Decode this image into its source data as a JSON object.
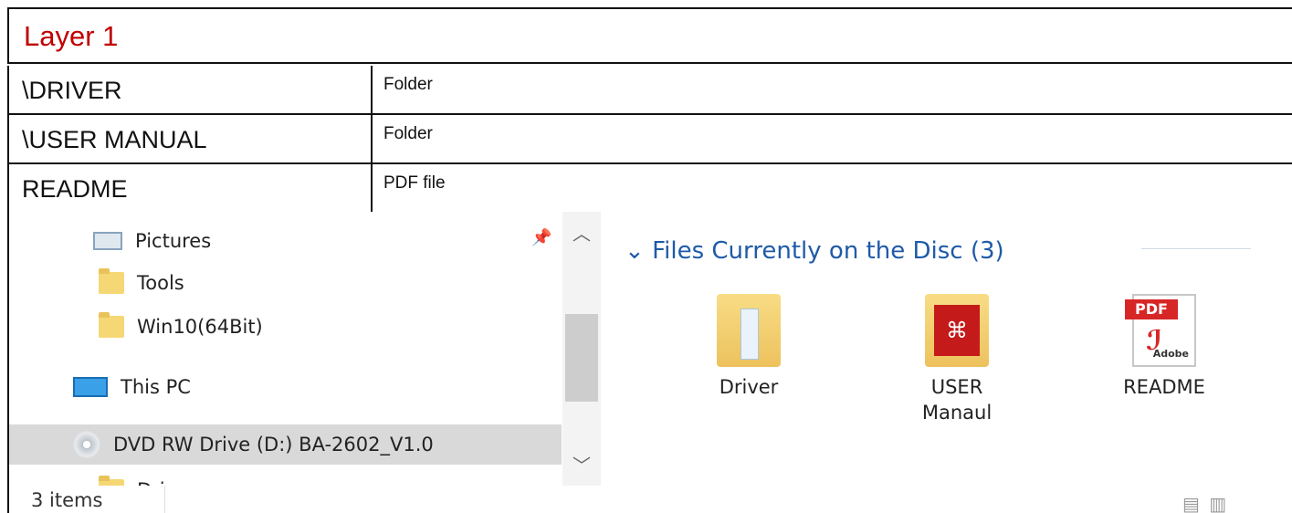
{
  "document": {
    "title": "Layer 1",
    "rows": [
      {
        "name": "\\DRIVER",
        "type": "Folder"
      },
      {
        "name": "\\USER MANUAL",
        "type": "Folder"
      },
      {
        "name": "README",
        "type": "PDF file"
      }
    ]
  },
  "explorer": {
    "nav_items": [
      {
        "label": "Pictures",
        "icon": "pictures-icon"
      },
      {
        "label": "Tools",
        "icon": "folder-icon"
      },
      {
        "label": "Win10(64Bit)",
        "icon": "folder-icon"
      },
      {
        "label": "This PC",
        "icon": "computer-icon"
      },
      {
        "label": "DVD RW Drive (D:) BA-2602_V1.0",
        "icon": "dvd-drive-icon"
      },
      {
        "label": "Dri",
        "icon": "folder-icon"
      }
    ],
    "group_header": "Files Currently on the Disc (3)",
    "group_chevron": "⌄",
    "files": [
      {
        "label": "Driver",
        "icon": "folder-icon"
      },
      {
        "label": "USER",
        "label2": "Manaul",
        "icon": "pdf-folder-icon"
      },
      {
        "label": "README",
        "icon": "pdf-file-icon"
      }
    ],
    "status_text": "3 items",
    "view_icons": "▤ ▥",
    "colors": {
      "title": "#c00000",
      "group_header": "#1e5aa8",
      "selected": "#d9d9d9"
    }
  }
}
